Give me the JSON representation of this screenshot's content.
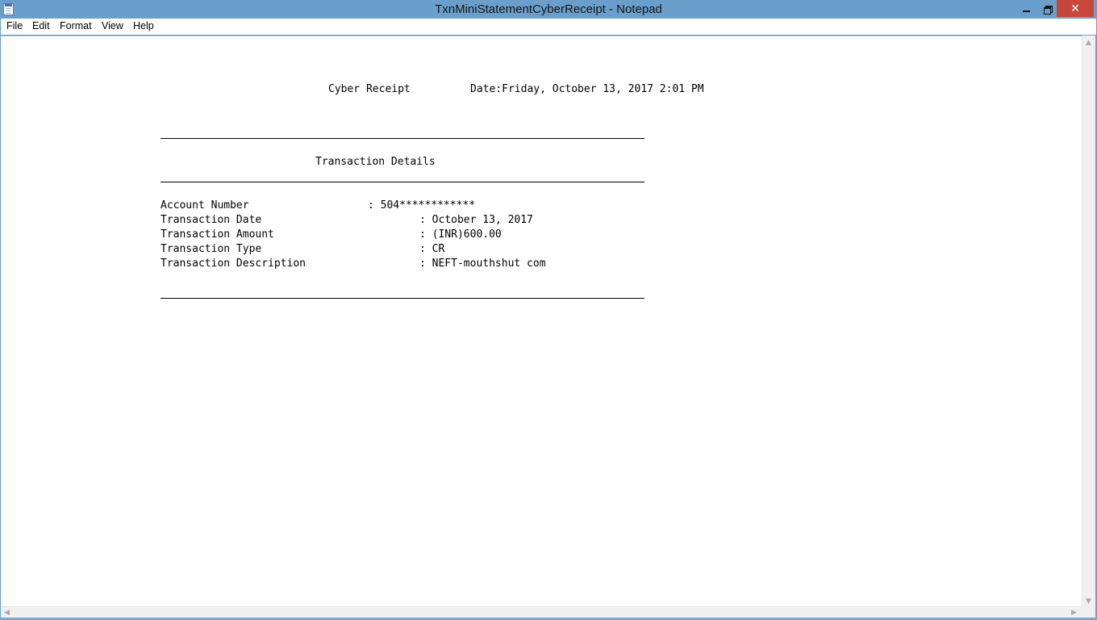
{
  "window": {
    "title": "TxnMiniStatementCyberReceipt - Notepad",
    "close_glyph": "✕"
  },
  "menu": {
    "file": "File",
    "edit": "Edit",
    "format": "Format",
    "view": "View",
    "help": "Help"
  },
  "document": {
    "header_receipt": "Cyber Receipt",
    "header_date": "Date:Friday, October 13, 2017 2:01 PM",
    "section_title": "Transaction Details",
    "rows": [
      {
        "label": "Account Number",
        "value": ": 504************"
      },
      {
        "label": "Transaction Date",
        "value": ": October 13, 2017"
      },
      {
        "label": "Transaction Amount",
        "value": ": (INR)600.00"
      },
      {
        "label": "Transaction Type",
        "value": ": CR"
      },
      {
        "label": "Transaction Description",
        "value": ": NEFT-mouthshut com"
      }
    ]
  },
  "scrollbar_glyphs": {
    "up": "▲",
    "down": "▼",
    "left": "◀",
    "right": "▶"
  },
  "colors": {
    "titlebar": "#6b9fcb",
    "close_button": "#c7473d",
    "editor_background": "#ffffff"
  }
}
